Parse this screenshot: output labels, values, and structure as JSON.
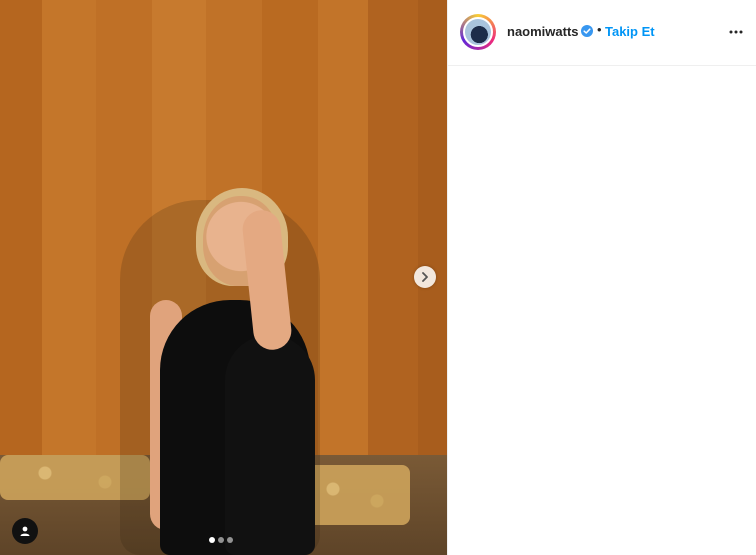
{
  "post": {
    "author": {
      "username": "naomiwatts",
      "verified": true,
      "avatar_icon": "profile-avatar"
    },
    "separator": "•",
    "follow_label": "Takip Et",
    "more_icon": "more-options-icon",
    "carousel": {
      "current_index": 1,
      "total": 3,
      "next_icon": "chevron-right-icon"
    },
    "tag_icon": "user-tag-icon"
  },
  "colors": {
    "follow": "#0095f6",
    "text": "#262626",
    "verified": "#3897f0"
  }
}
